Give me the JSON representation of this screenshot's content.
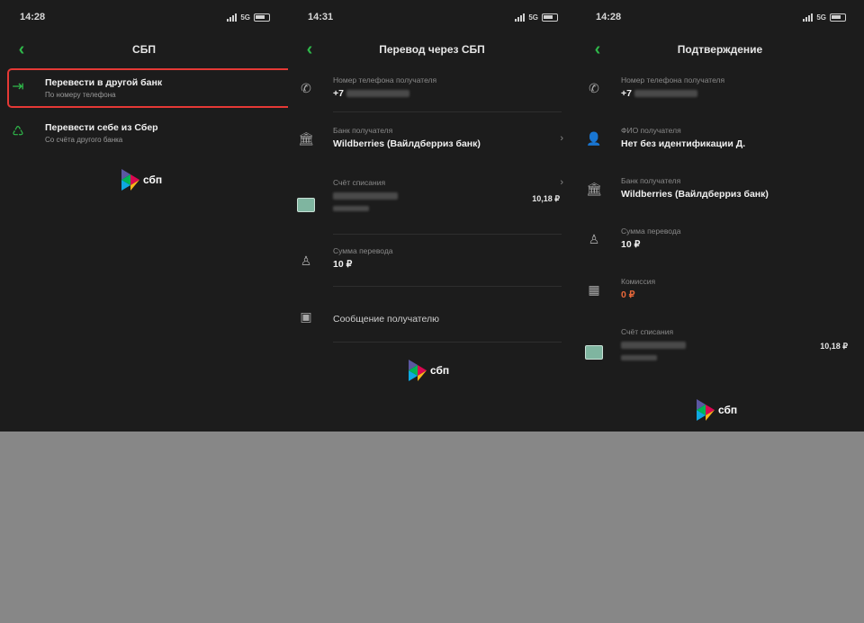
{
  "screen1": {
    "time": "14:28",
    "net": "5G",
    "title": "СБП",
    "items": [
      {
        "label": "Перевести в другой банк",
        "sub": "По номеру телефона"
      },
      {
        "label": "Перевести себе из Сбер",
        "sub": "Со счёта другого банка"
      }
    ],
    "logo": "сбп"
  },
  "screen2": {
    "time": "14:31",
    "net": "5G",
    "title": "Перевод через СБП",
    "phone_label": "Номер телефона получателя",
    "phone_prefix": "+7",
    "bank_label": "Банк получателя",
    "bank_value": "Wildberries (Вайлдберриз банк)",
    "account_label": "Счёт списания",
    "account_amount": "10,18 ₽",
    "sum_label": "Сумма перевода",
    "sum_value": "10 ₽",
    "message_label": "Сообщение получателю",
    "logo": "сбп"
  },
  "screen3": {
    "time": "14:28",
    "net": "5G",
    "title": "Подтверждение",
    "phone_label": "Номер телефона получателя",
    "phone_prefix": "+7",
    "fio_label": "ФИО получателя",
    "fio_value": "Нет без идентификации Д.",
    "bank_label": "Банк получателя",
    "bank_value": "Wildberries (Вайлдберриз банк)",
    "sum_label": "Сумма перевода",
    "sum_value": "10 ₽",
    "commission_label": "Комиссия",
    "commission_value": "0 ₽",
    "account_label": "Счёт списания",
    "account_amount": "10,18 ₽",
    "logo": "сбп"
  },
  "colors": {
    "accent_green": "#2fb84a",
    "highlight_red": "#e53935",
    "commission_orange": "#e8683a",
    "background": "#1c1c1c"
  }
}
